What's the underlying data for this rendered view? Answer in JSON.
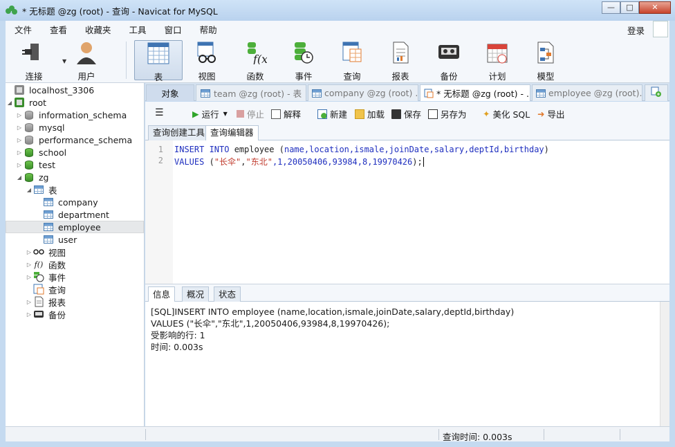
{
  "window": {
    "title": "* 无标题 @zg (root) - 查询 - Navicat for MySQL"
  },
  "menu": {
    "items": [
      "文件",
      "查看",
      "收藏夹",
      "工具",
      "窗口",
      "帮助"
    ],
    "login": "登录"
  },
  "toolbar": {
    "connect": "连接",
    "user": "用户",
    "table": "表",
    "view": "视图",
    "function": "函数",
    "event": "事件",
    "query": "查询",
    "report": "报表",
    "backup": "备份",
    "schedule": "计划",
    "model": "模型"
  },
  "tree": {
    "connection": "localhost_3306",
    "root": "root",
    "databases": [
      "information_schema",
      "mysql",
      "performance_schema",
      "school",
      "test",
      "zg"
    ],
    "tables_group": "表",
    "tables": [
      "company",
      "department",
      "employee",
      "user"
    ],
    "groups": [
      "视图",
      "函数",
      "事件",
      "查询",
      "报表",
      "备份"
    ]
  },
  "tabs": {
    "objects": "对象",
    "items": [
      "team @zg (root) - 表",
      "company @zg (root) ...",
      "* 无标题 @zg (root) - ...",
      "employee @zg (root)..."
    ]
  },
  "query_toolbar": {
    "run": "运行",
    "stop": "停止",
    "explain": "解释",
    "new": "新建",
    "load": "加载",
    "save": "保存",
    "save_as": "另存为",
    "beautify": "美化 SQL",
    "export": "导出"
  },
  "subtabs": {
    "builder": "查询创建工具",
    "editor": "查询编辑器"
  },
  "editor": {
    "line_numbers": [
      "1",
      "2"
    ],
    "line1": {
      "kw1": "INSERT INTO",
      "table": " employee ",
      "cols_open": "(",
      "cols": "name,location,ismale,joinDate,salary,deptId,birthday",
      "cols_close": ")"
    },
    "line2": {
      "kw": "VALUES",
      "open": " (",
      "s1": "\"长伞\"",
      "c1": ",",
      "s2": "\"东北\"",
      "rest": ",1,20050406,93984,8,19970426",
      "close": ");"
    }
  },
  "result_tabs": {
    "info": "信息",
    "overview": "概况",
    "status": "状态"
  },
  "info": {
    "lines": [
      "[SQL]INSERT INTO employee (name,location,ismale,joinDate,salary,deptId,birthday)",
      "VALUES (\"长伞\",\"东北\",1,20050406,93984,8,19970426);",
      "受影响的行: 1",
      "时间: 0.003s"
    ]
  },
  "statusbar": {
    "query_time": "查询时间: 0.003s"
  }
}
